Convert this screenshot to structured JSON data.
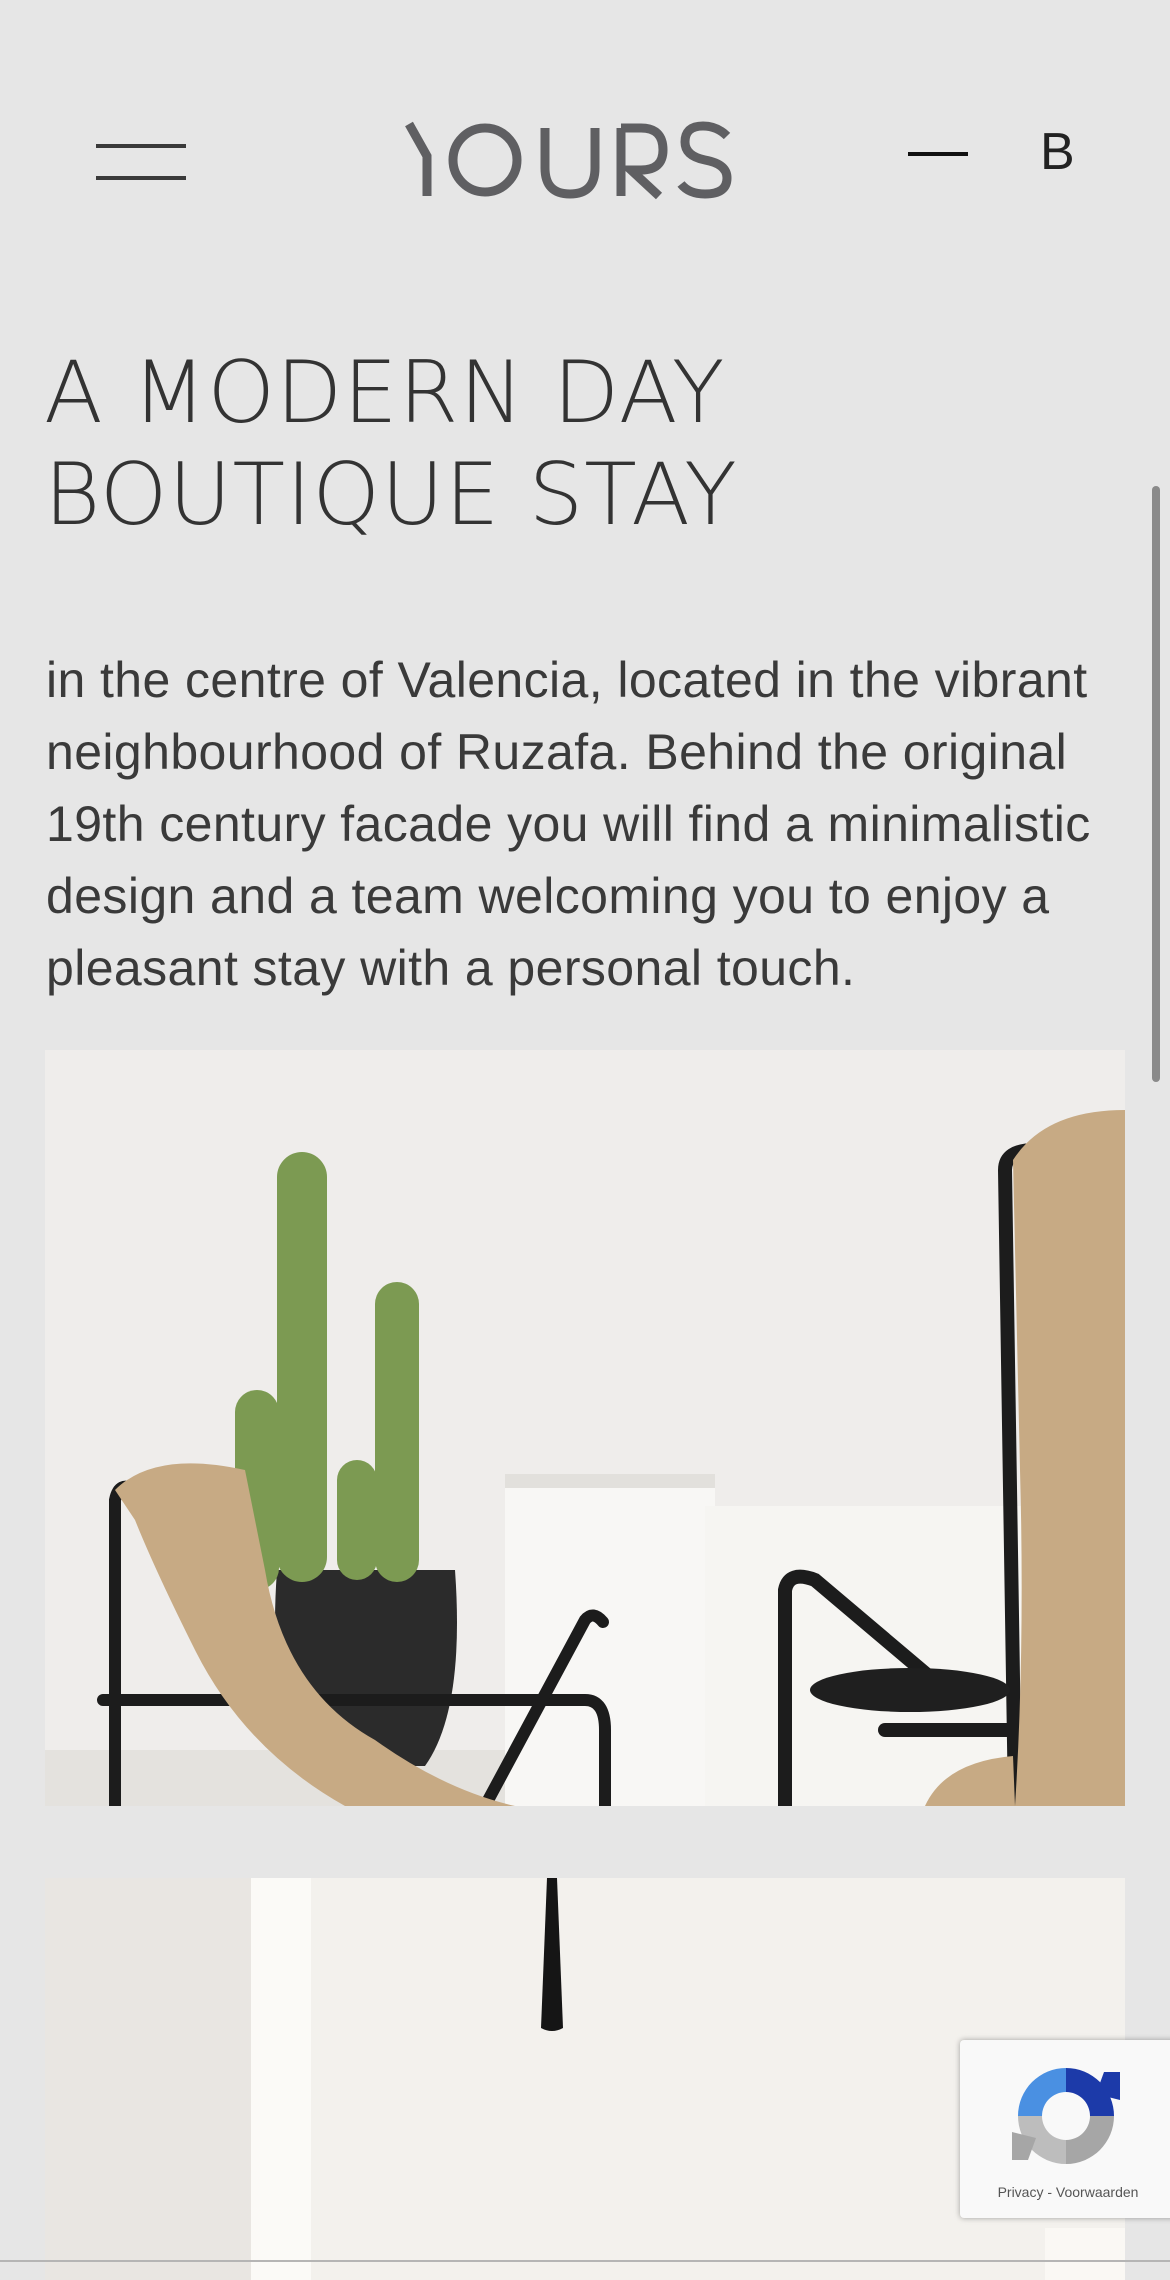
{
  "header": {
    "logo_text": "YOURS",
    "language_label": "B",
    "menu_icon": "hamburger-menu-icon"
  },
  "hero": {
    "headline_line1": "A MODERN DAY",
    "headline_line2": "BOUTIQUE STAY",
    "intro_lines": [
      "in the centre of Valencia, located in the vibrant",
      "neighbourhood of Ruzafa. Behind the original",
      "19th century facade you will find a minimalistic",
      "design and a team welcoming you to enjoy a",
      "pleasant stay with a personal touch."
    ]
  },
  "recaptcha": {
    "privacy_label": "Privacy",
    "separator": "-",
    "terms_label": "Voorwaarden",
    "icon": "recaptcha-icon"
  },
  "colors": {
    "background": "#e6e6e6",
    "text": "#333333",
    "logo": "#5f5f62",
    "photo_wall": "#efedeb",
    "canvas_sling": "#c7aa84",
    "cactus_green": "#7c9a52"
  }
}
